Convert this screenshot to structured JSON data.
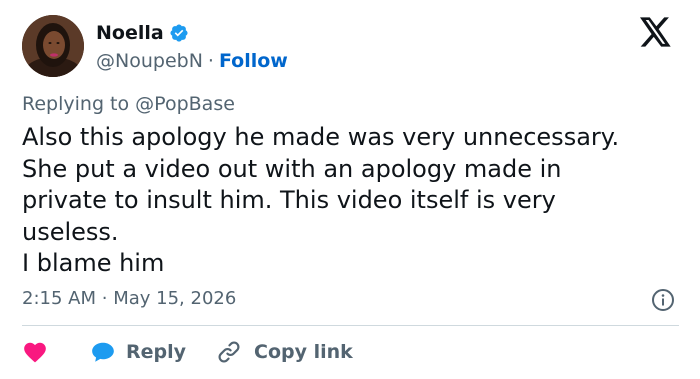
{
  "author": {
    "name": "Noella",
    "handle": "@NoupebN",
    "separator": "·",
    "follow_label": "Follow",
    "verified_color": "#1d9bf0"
  },
  "reply_context": {
    "prefix": "Replying to",
    "mention": "@PopBase"
  },
  "tweet": {
    "text": "Also this apology he made was very unnecessary.\nShe put a video out with an apology made in\nprivate to insult him. This video itself is very\nuseless.\nI blame him",
    "time": "2:15 AM",
    "date_separator": "·",
    "date": "May 15, 2026"
  },
  "actions": {
    "like_color": "#f91880",
    "reply_label": "Reply",
    "reply_color": "#1d9bf0",
    "copy_label": "Copy link"
  },
  "icons": {
    "brand": "x-logo-icon",
    "info": "info-icon",
    "like": "heart-icon",
    "reply": "speech-bubble-icon",
    "copy": "link-icon"
  }
}
